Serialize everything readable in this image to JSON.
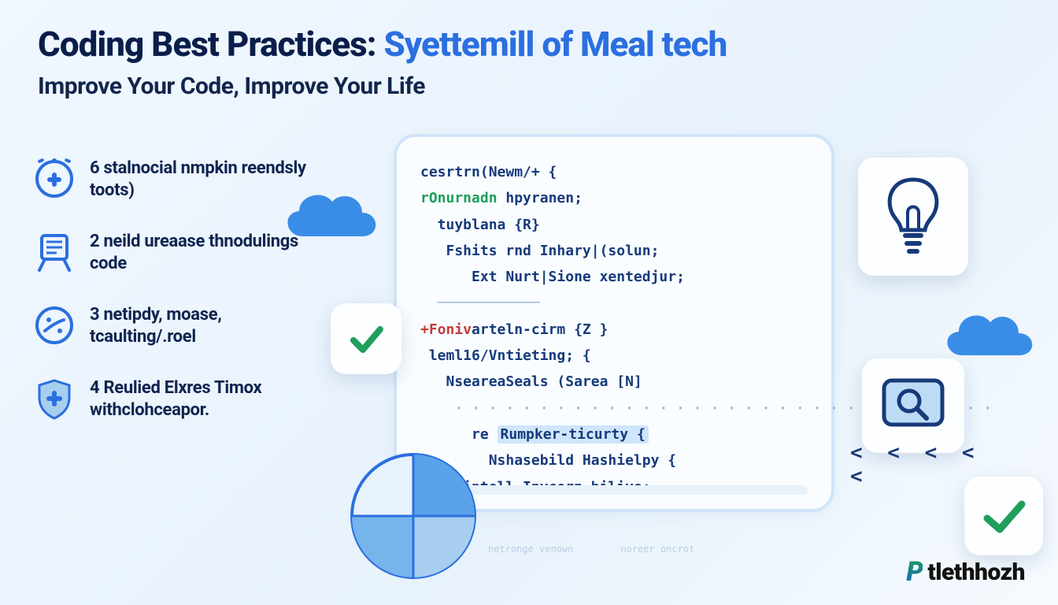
{
  "header": {
    "title_main": "Coding Best Practices:",
    "title_accent": "Syettemill of Meal tech",
    "subtitle": "Improve Your Code, Improve Your Life"
  },
  "sidebar": {
    "items": [
      {
        "icon": "clock-plus-icon",
        "text": "6 stalnocial nmpkin reendsly toots)"
      },
      {
        "icon": "board-icon",
        "text": "2 neild ureaase thnodulings code"
      },
      {
        "icon": "divide-icon",
        "text": "3 netipdy, moase, tcaulting/.roel"
      },
      {
        "icon": "shield-plus-icon",
        "text": "4 Reulied Elxres Timox withclohceapor."
      }
    ]
  },
  "code": {
    "l1": "cesrtrn(Newm/+ {",
    "l2_kw": "rOnurnadn",
    "l2_rest": " hpyranen;",
    "l3": "  tuyblana {R}",
    "l4": "   Fshits rnd Inhary|(solun;",
    "l5": "      Ext Nurt|Sione xentedjur;",
    "l6_kw": "+Foniv",
    "l6_rest": "arteln-cirm {Z }",
    "l7": " leml16/Vntieting; {",
    "l8": "   NseareaSeals (Sarea [N]",
    "l9a": "      re ",
    "l9b": "Rumpker-ticurty {",
    "l10": "        Nshasebild Hashielpy {",
    "l11": "   | intell Inycorn bilive;"
  },
  "cards": {
    "check_small_label": "checkmark",
    "bulb_label": "lightbulb",
    "search_label": "search",
    "check_green_label": "checkmark"
  },
  "chevrons": "< < < < <",
  "logo": {
    "mark": "P",
    "text": "tlethhozh"
  },
  "footer_faint": [
    "netronge venown",
    "noreer oncrot"
  ]
}
